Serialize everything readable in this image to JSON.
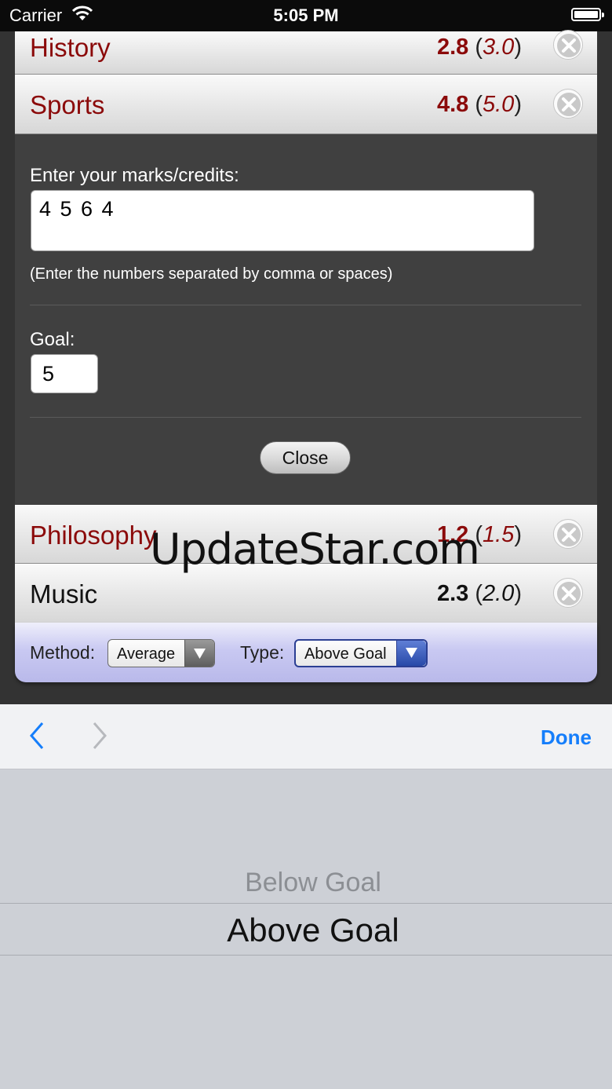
{
  "status_bar": {
    "carrier": "Carrier",
    "time": "5:05 PM"
  },
  "subjects": [
    {
      "name": "History",
      "average": "2.8",
      "goal": "3.0"
    },
    {
      "name": "Sports",
      "average": "4.8",
      "goal": "5.0"
    },
    {
      "name": "Philosophy",
      "average": "1.2",
      "goal": "1.5"
    },
    {
      "name": "Music",
      "average": "2.3",
      "goal": "2.0"
    }
  ],
  "editor": {
    "marks_label": "Enter your marks/credits:",
    "marks_value": "4 5 6 4",
    "hint": "(Enter the numbers separated by comma or spaces)",
    "goal_label": "Goal:",
    "goal_value": "5",
    "close_label": "Close"
  },
  "settings": {
    "method_label": "Method:",
    "method_value": "Average",
    "type_label": "Type:",
    "type_value": "Above Goal"
  },
  "accessory": {
    "done_label": "Done"
  },
  "picker": {
    "options": [
      "Below Goal",
      "Above Goal"
    ],
    "selected": "Above Goal"
  },
  "watermark": "UpdateStar.com",
  "colors": {
    "red_text": "#8b0a0a",
    "ios_blue": "#157efb",
    "panel_bg": "#404040",
    "bar_lavender": "#c9c9f2"
  },
  "icons": {
    "delete": "circle-x-icon",
    "prev": "chevron-left-icon",
    "next": "chevron-right-icon",
    "dropdown": "triangle-down-icon",
    "wifi": "wifi-icon",
    "battery": "battery-icon"
  }
}
